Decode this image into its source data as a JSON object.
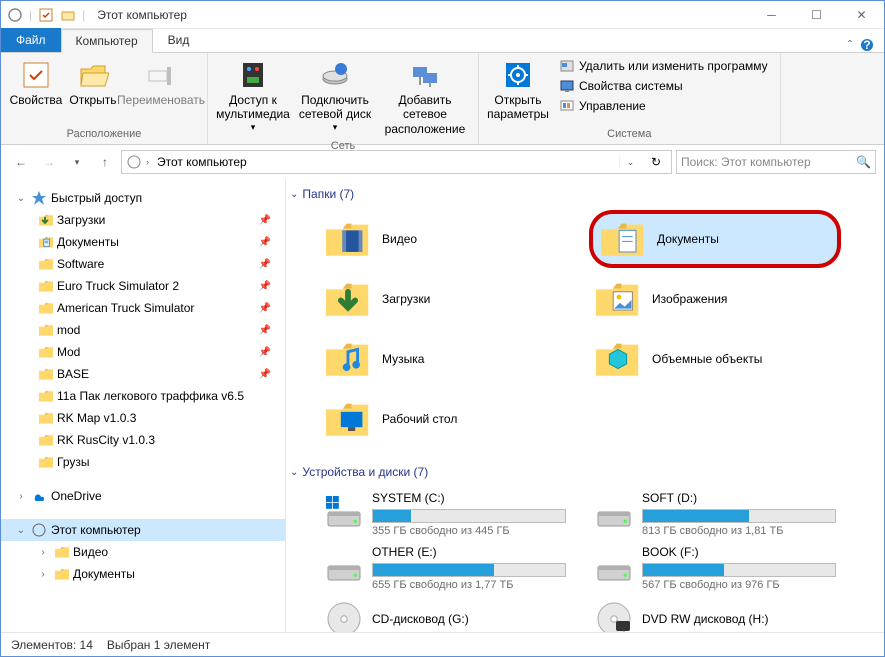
{
  "window": {
    "title": "Этот компьютер"
  },
  "tabs": {
    "file": "Файл",
    "computer": "Компьютер",
    "view": "Вид"
  },
  "ribbon": {
    "location": {
      "properties": "Свойства",
      "open": "Открыть",
      "rename": "Переименовать",
      "label": "Расположение"
    },
    "network": {
      "media": "Доступ к мультимедиа",
      "mapdrive": "Подключить сетевой диск",
      "addnet": "Добавить сетевое расположение",
      "label": "Сеть"
    },
    "system": {
      "openparams": "Открыть параметры",
      "uninstall": "Удалить или изменить программу",
      "sysprops": "Свойства системы",
      "manage": "Управление",
      "label": "Система"
    }
  },
  "address": {
    "location": "Этот компьютер"
  },
  "search": {
    "placeholder": "Поиск: Этот компьютер"
  },
  "tree": {
    "quick": "Быстрый доступ",
    "items": [
      {
        "label": "Загрузки",
        "pin": true,
        "icon": "down"
      },
      {
        "label": "Документы",
        "pin": true,
        "icon": "doc"
      },
      {
        "label": "Software",
        "pin": true,
        "icon": "fld"
      },
      {
        "label": "Euro Truck Simulator 2",
        "pin": true,
        "icon": "fld"
      },
      {
        "label": "American Truck Simulator",
        "pin": true,
        "icon": "fld"
      },
      {
        "label": "mod",
        "pin": true,
        "icon": "fld"
      },
      {
        "label": "Mod",
        "pin": true,
        "icon": "fld"
      },
      {
        "label": "BASE",
        "pin": true,
        "icon": "fld"
      },
      {
        "label": "11a Пак легкового траффика v6.5",
        "pin": false,
        "icon": "fld"
      },
      {
        "label": "RK Map v1.0.3",
        "pin": false,
        "icon": "fld"
      },
      {
        "label": "RK RusCity v1.0.3",
        "pin": false,
        "icon": "fld"
      },
      {
        "label": "Грузы",
        "pin": false,
        "icon": "fld"
      }
    ],
    "onedrive": "OneDrive",
    "thispc": "Этот компьютер",
    "pcitems": [
      {
        "label": "Видео"
      },
      {
        "label": "Документы"
      }
    ]
  },
  "folders": {
    "header": "Папки (7)",
    "items": [
      {
        "label": "Видео",
        "icon": "video"
      },
      {
        "label": "Документы",
        "icon": "doc",
        "hl": true
      },
      {
        "label": "Загрузки",
        "icon": "down"
      },
      {
        "label": "Изображения",
        "icon": "img"
      },
      {
        "label": "Музыка",
        "icon": "music"
      },
      {
        "label": "Объемные объекты",
        "icon": "3d"
      },
      {
        "label": "Рабочий стол",
        "icon": "desk"
      }
    ]
  },
  "drives": {
    "header": "Устройства и диски (7)",
    "items": [
      {
        "label": "SYSTEM (C:)",
        "free": "355 ГБ свободно из 445 ГБ",
        "pct": 20,
        "icon": "sys"
      },
      {
        "label": "SOFT (D:)",
        "free": "813 ГБ свободно из 1,81 ТБ",
        "pct": 55,
        "icon": "hdd"
      },
      {
        "label": "OTHER (E:)",
        "free": "655 ГБ свободно из 1,77 ТБ",
        "pct": 63,
        "icon": "hdd"
      },
      {
        "label": "BOOK (F:)",
        "free": "567 ГБ свободно из 976 ГБ",
        "pct": 42,
        "icon": "hdd"
      },
      {
        "label": "CD-дисковод (G:)",
        "icon": "cd"
      },
      {
        "label": "DVD RW дисковод (H:)",
        "icon": "dvd"
      }
    ]
  },
  "status": {
    "count": "Элементов: 14",
    "sel": "Выбран 1 элемент"
  }
}
